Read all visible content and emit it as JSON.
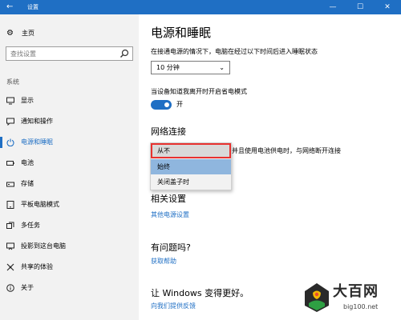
{
  "window": {
    "title": "设置",
    "back_glyph": "←",
    "minimize_glyph": "—",
    "maximize_glyph": "☐",
    "close_glyph": "✕",
    "accent": "#1f6fc4"
  },
  "sidebar": {
    "home_label": "主页",
    "search_placeholder": "查找设置",
    "section_label": "系统",
    "items": [
      {
        "label": "显示",
        "icon": "monitor-icon"
      },
      {
        "label": "通知和操作",
        "icon": "notification-icon"
      },
      {
        "label": "电源和睡眠",
        "icon": "power-icon",
        "active": true
      },
      {
        "label": "电池",
        "icon": "battery-icon"
      },
      {
        "label": "存储",
        "icon": "storage-icon"
      },
      {
        "label": "平板电脑模式",
        "icon": "tablet-icon"
      },
      {
        "label": "多任务",
        "icon": "multitask-icon"
      },
      {
        "label": "投影到这台电脑",
        "icon": "project-icon"
      },
      {
        "label": "共享的体验",
        "icon": "share-icon"
      },
      {
        "label": "关于",
        "icon": "info-icon"
      }
    ]
  },
  "main": {
    "title": "电源和睡眠",
    "sleep_desc": "在接通电源的情况下，电脑在经过以下时间后进入睡眠状态",
    "sleep_value": "10 分钟",
    "away_mode_label": "当设备知道我离开时开启省电模式",
    "toggle_state": "开",
    "network_heading": "网络连接",
    "network_desc_tail": "并且使用电池供电时，与网络断开连接",
    "network_options": [
      "从不",
      "始终",
      "关闭盖子时"
    ],
    "network_selected": "从不",
    "related_heading": "相关设置",
    "related_link": "其他电源设置",
    "question_heading": "有问题吗?",
    "help_link": "获取帮助",
    "improve_heading": "让 Windows 变得更好。",
    "feedback_link": "向我们提供反馈"
  },
  "watermark": {
    "name": "大百网",
    "url": "big100.net"
  }
}
